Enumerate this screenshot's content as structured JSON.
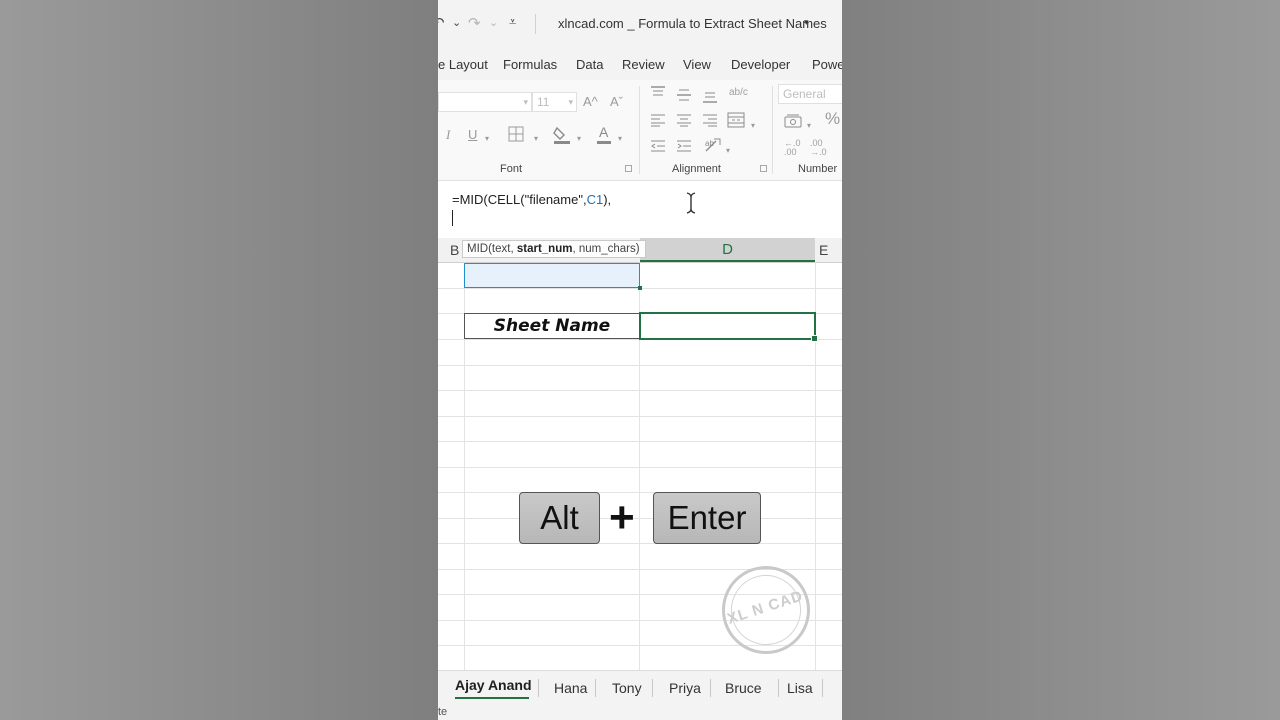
{
  "titlebar": {
    "doc_title": "xlncad.com _ Formula to Extract Sheet Names",
    "title_caret": "▾"
  },
  "quick_access": {
    "undo_glyph": "↶",
    "redo_glyph": "↷",
    "caret": "⌄",
    "customize": "⩡"
  },
  "ribbon_tabs": [
    "e Layout",
    "Formulas",
    "Data",
    "Review",
    "View",
    "Developer",
    "Powe"
  ],
  "ribbon": {
    "font_name": "",
    "font_size": "11",
    "number_format": "General",
    "groups": {
      "font": "Font",
      "alignment": "Alignment",
      "number": "Number"
    },
    "icons": [
      "increase-font-icon",
      "decrease-font-icon",
      "italic-icon",
      "underline-icon",
      "borders-icon",
      "fill-color-icon",
      "font-color-icon",
      "align-top-icon",
      "align-middle-icon",
      "align-bottom-icon",
      "wrap-text-icon",
      "align-left-icon",
      "align-center-icon",
      "align-right-icon",
      "merge-icon",
      "decrease-indent-icon",
      "increase-indent-icon",
      "orientation-icon",
      "currency-icon",
      "percent-icon",
      "increase-decimal-icon",
      "decrease-decimal-icon"
    ],
    "labels": {
      "increase_font": "A^",
      "decrease_font": "Aˇ",
      "italic": "I",
      "underline": "U",
      "fill": "⬙",
      "font_color": "A",
      "wrap": "ab/c",
      "percent": "%",
      "inc_dec": "←.0 .00",
      "dec_dec": ".00 →.0"
    }
  },
  "formula_bar": {
    "formula_before": "=MID(CELL(\"filename\",",
    "formula_ref": "C1",
    "formula_after": "),"
  },
  "tooltip": {
    "func": "MID(text, ",
    "bold_arg": "start_num",
    "rest": ", num_chars)"
  },
  "columns": {
    "b": "B",
    "d": "D",
    "e": "E"
  },
  "cells": {
    "sheet_name_label": "Sheet Name"
  },
  "overlay": {
    "key1": "Alt",
    "plus": "+",
    "key2": "Enter"
  },
  "watermark": {
    "text": "XL N CAD"
  },
  "sheet_tabs": [
    "Ajay Anand",
    "Hana",
    "Tony",
    "Priya",
    "Bruce",
    "Lisa"
  ],
  "active_sheet": "Ajay Anand",
  "status_text": "te",
  "colors": {
    "excel_green": "#217346",
    "selection_blue": "#1f8fcf",
    "formula_ref": "#1f6fb3"
  }
}
